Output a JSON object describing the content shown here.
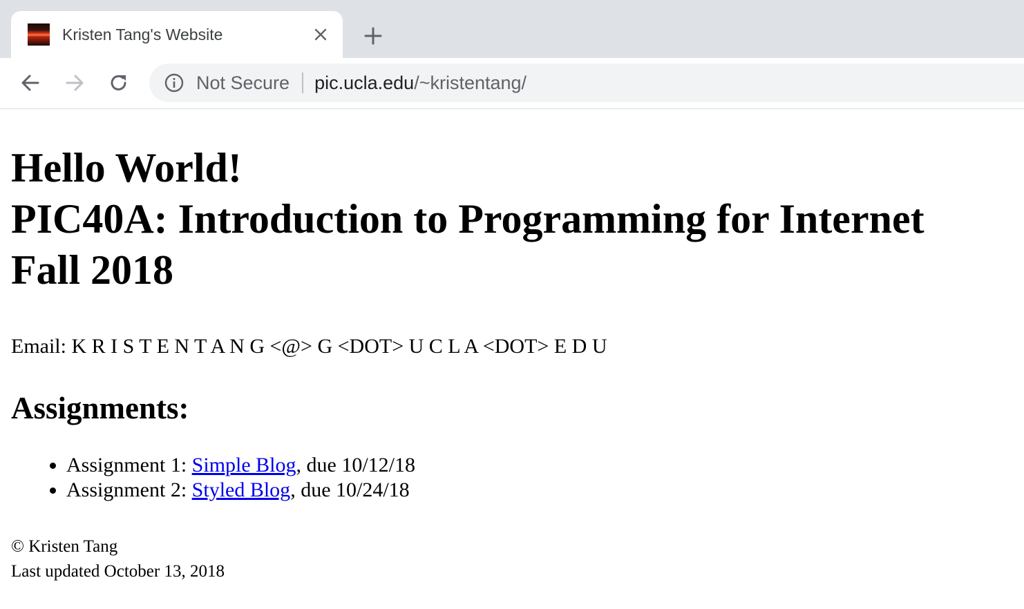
{
  "browser": {
    "tab_title": "Kristen Tang's Website",
    "security_label": "Not Secure",
    "url_host": "pic.ucla.edu",
    "url_path": "/~kristentang/"
  },
  "page": {
    "heading_line1": "Hello World!",
    "heading_line2": "PIC40A: Introduction to Programming for Internet",
    "heading_line3": "Fall 2018",
    "email": "Email: K R I S T E N T A N G <@> G <DOT> U C L A <DOT> E D U",
    "assignments_heading": "Assignments:",
    "assignments": [
      {
        "prefix": "Assignment 1: ",
        "link": "Simple Blog",
        "suffix": ", due 10/12/18"
      },
      {
        "prefix": "Assignment 2: ",
        "link": "Styled Blog",
        "suffix": ", due 10/24/18"
      }
    ],
    "copyright": "© Kristen Tang",
    "last_updated": "Last updated October 13, 2018"
  }
}
